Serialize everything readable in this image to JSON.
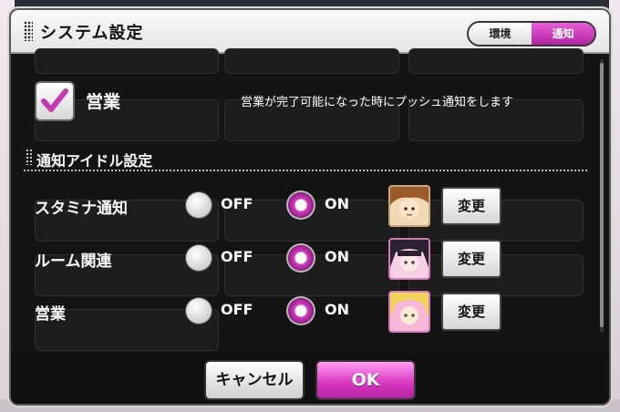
{
  "dialog": {
    "title": "システム設定",
    "tabs": [
      "環境",
      "通知"
    ]
  },
  "sales_toggle": {
    "label": "営業",
    "checked": true,
    "description": "営業が完了可能になった時にプッシュ通知をします"
  },
  "section": {
    "title": "通知アイドル設定"
  },
  "rows": [
    {
      "label": "スタミナ通知",
      "off": "OFF",
      "on": "ON",
      "selected": "ON",
      "button": "変更"
    },
    {
      "label": "ルーム関連",
      "off": "OFF",
      "on": "ON",
      "selected": "ON",
      "button": "変更"
    },
    {
      "label": "営業",
      "off": "OFF",
      "on": "ON",
      "selected": "ON",
      "button": "変更"
    }
  ],
  "footer": {
    "cancel": "キャンセル",
    "ok": "OK"
  },
  "colors": {
    "accent": "#d63ec4",
    "tab_active": "#c23bb3"
  }
}
